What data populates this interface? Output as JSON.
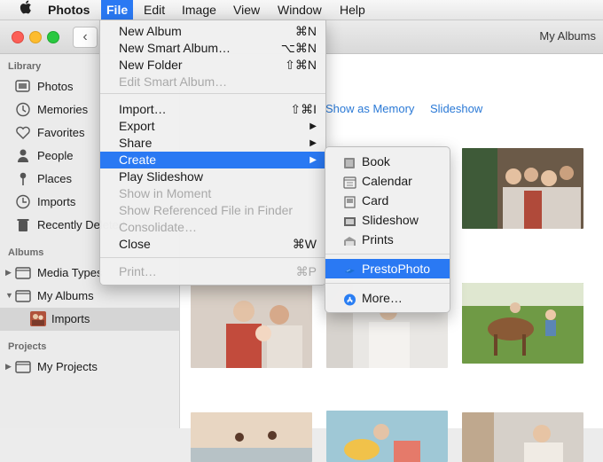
{
  "menubar": {
    "items": [
      "Photos",
      "File",
      "Edit",
      "Image",
      "View",
      "Window",
      "Help"
    ]
  },
  "window": {
    "title": "My Albums",
    "back_label": "‹"
  },
  "sidebar": {
    "library_header": "Library",
    "library_items": [
      "Photos",
      "Memories",
      "Favorites",
      "People",
      "Places",
      "Imports",
      "Recently Deleted"
    ],
    "albums_header": "Albums",
    "album_items": [
      "Media Types",
      "My Albums",
      "Imports"
    ],
    "projects_header": "Projects",
    "project_items": [
      "My Projects"
    ]
  },
  "content": {
    "show_as_memory": "Show as Memory",
    "slideshow": "Slideshow"
  },
  "file_menu": {
    "items": [
      {
        "label": "New Album",
        "shortcut": "⌘N"
      },
      {
        "label": "New Smart Album…",
        "shortcut": "⌥⌘N"
      },
      {
        "label": "New Folder",
        "shortcut": "⇧⌘N"
      },
      {
        "label": "Edit Smart Album…",
        "shortcut": ""
      },
      {
        "label": "Import…",
        "shortcut": "⇧⌘I"
      },
      {
        "label": "Export",
        "shortcut": "▶"
      },
      {
        "label": "Share",
        "shortcut": "▶"
      },
      {
        "label": "Create",
        "shortcut": "▶"
      },
      {
        "label": "Play Slideshow",
        "shortcut": ""
      },
      {
        "label": "Show in Moment",
        "shortcut": ""
      },
      {
        "label": "Show Referenced File in Finder",
        "shortcut": ""
      },
      {
        "label": "Consolidate…",
        "shortcut": ""
      },
      {
        "label": "Close",
        "shortcut": "⌘W"
      },
      {
        "label": "Print…",
        "shortcut": "⌘P"
      }
    ]
  },
  "create_submenu": {
    "items": [
      "Book",
      "Calendar",
      "Card",
      "Slideshow",
      "Prints",
      "PrestoPhoto",
      "More…"
    ]
  },
  "colors": {
    "accent": "#2a79f3",
    "link": "#2a79d6"
  }
}
